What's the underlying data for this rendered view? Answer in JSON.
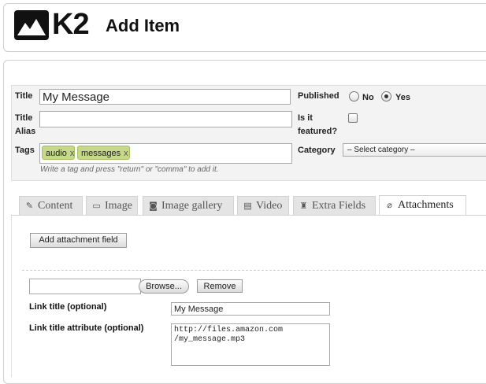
{
  "header": {
    "logo_text": "K2",
    "page_title": "Add Item"
  },
  "form": {
    "title_label": "Title",
    "title_value": "My Message",
    "alias_label_1": "Title",
    "alias_label_2": "Alias",
    "alias_value": "",
    "tags_label": "Tags",
    "tags": [
      "audio",
      "messages"
    ],
    "tag_remove": "x",
    "tags_hint": "Write a tag and press \"return\" or \"comma\" to add it.",
    "published_label": "Published",
    "published_options": [
      {
        "label": "No",
        "selected": false
      },
      {
        "label": "Yes",
        "selected": true
      }
    ],
    "featured_label_1": "Is it",
    "featured_label_2": "featured?",
    "featured_checked": false,
    "category_label": "Category",
    "category_value": "– Select category –"
  },
  "tabs": [
    {
      "label": "Content",
      "icon": "edit-icon",
      "active": false
    },
    {
      "label": "Image",
      "icon": "image-icon",
      "active": false
    },
    {
      "label": "Image gallery",
      "icon": "camera-icon",
      "active": false
    },
    {
      "label": "Video",
      "icon": "film-icon",
      "active": false
    },
    {
      "label": "Extra Fields",
      "icon": "puzzle-icon",
      "active": false
    },
    {
      "label": "Attachments",
      "icon": "paperclip-icon",
      "active": true
    }
  ],
  "attachments": {
    "add_button": "Add attachment field",
    "browse_button": "Browse...",
    "remove_button": "Remove",
    "link_title_label": "Link title (optional)",
    "link_title_value": "My Message",
    "link_attr_label": "Link title attribute (optional)",
    "link_attr_value": "http://files.amazon.com\n/my_message.mp3"
  }
}
